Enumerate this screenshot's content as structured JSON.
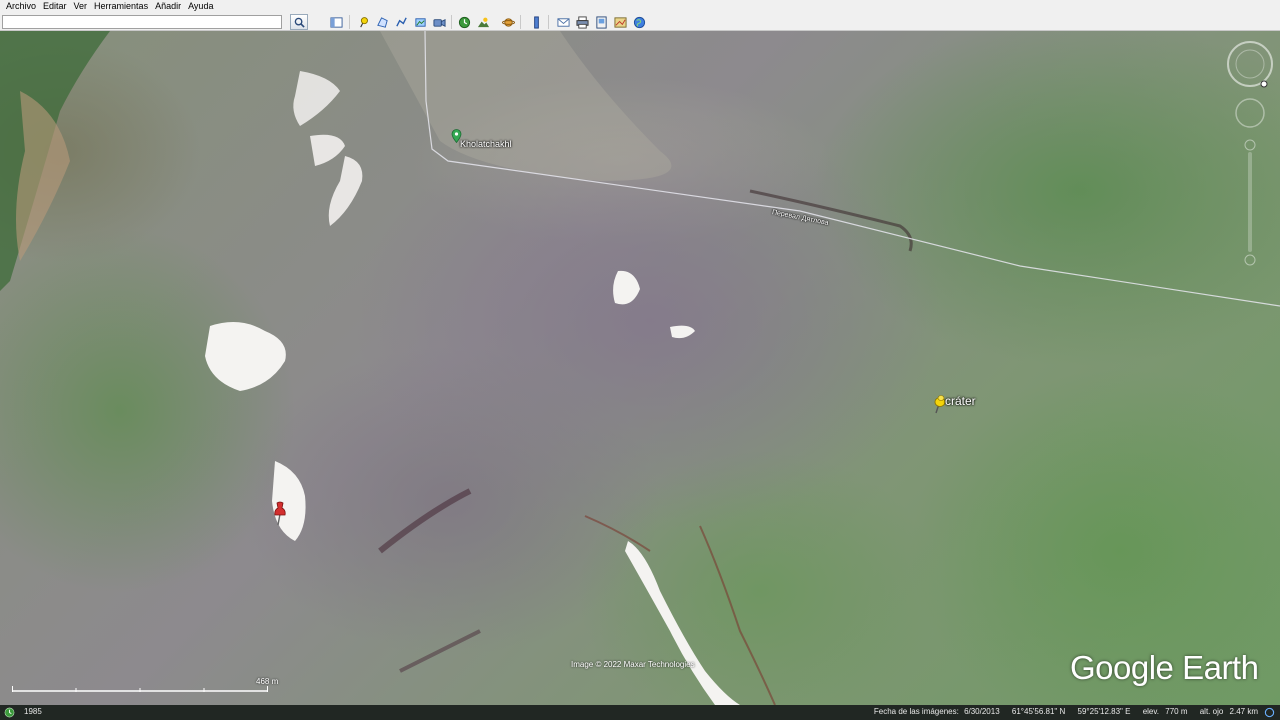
{
  "menu": {
    "items": [
      "Archivo",
      "Editar",
      "Ver",
      "Herramientas",
      "Añadir",
      "Ayuda"
    ]
  },
  "toolbar": {
    "search_value": "",
    "buttons": [
      "sidebar-icon",
      "placemark-icon",
      "polygon-icon",
      "path-icon",
      "overlay-icon",
      "tour-icon",
      "history-icon",
      "sunlight-icon",
      "planet-icon",
      "ruler-icon",
      "email-icon",
      "print-icon",
      "save-image-icon",
      "map-view-icon",
      "earth-icon"
    ]
  },
  "map": {
    "place_label": "Kholatchakhl",
    "road_label": "Перевал Дятлова",
    "crater_label": "cráter",
    "attribution": "Image © 2022 Maxar Technologies",
    "logo": "Google Earth",
    "scale_label": "468 m"
  },
  "status": {
    "year": "1985",
    "imagery_date_label": "Fecha de las imágenes:",
    "imagery_date": "6/30/2013",
    "latitude": "61°45'56.81\" N",
    "longitude": "59°25'12.83\" E",
    "elevation_label": "elev.",
    "elevation": "770 m",
    "eye_alt_label": "alt. ojo",
    "eye_alt": "2.47 km"
  },
  "colors": {
    "placemark_green": "#34a853",
    "pin_yellow": "#f4d40a",
    "pin_red": "#d32f2f",
    "status_bg": "#141919"
  }
}
